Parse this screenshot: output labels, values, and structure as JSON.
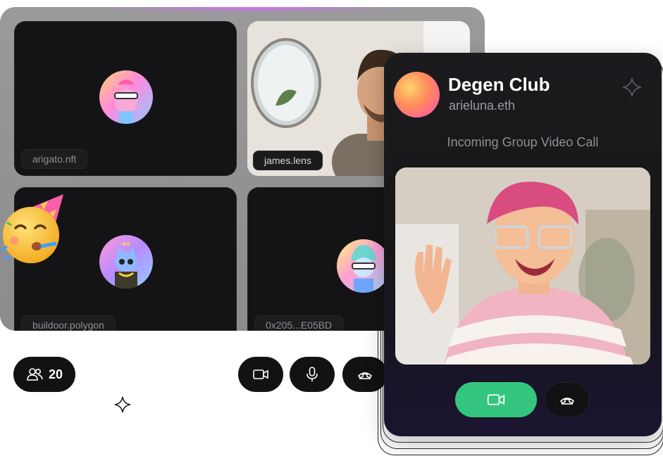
{
  "participants": [
    {
      "name": "arigato.nft"
    },
    {
      "name": "james.lens"
    },
    {
      "name": "buildoor.polygon"
    },
    {
      "name": "0x205...E05BD"
    }
  ],
  "participant_count": "20",
  "controls": {
    "participants_icon": "people-icon",
    "camera_icon": "video-camera-icon",
    "mic_icon": "microphone-icon",
    "hangup_icon": "phone-hangup-icon"
  },
  "incoming_call": {
    "group_name": "Degen Club",
    "caller_handle": "arieluna.eth",
    "status": "Incoming Group Video Call",
    "accept_icon": "video-camera-icon",
    "decline_icon": "phone-hangup-icon",
    "accept_color": "#34c57e"
  },
  "decorations": {
    "emoji": "🥳",
    "sparkle_icon": "sparkle-icon"
  }
}
